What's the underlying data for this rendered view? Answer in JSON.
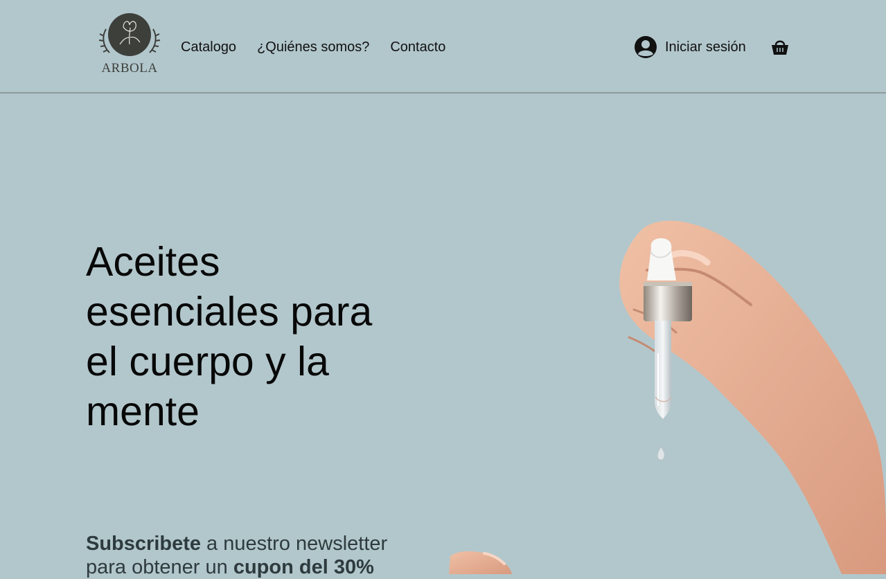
{
  "header": {
    "brand": "ARBOLA",
    "nav": [
      {
        "label": "Catalogo"
      },
      {
        "label": "¿Quiénes somos?"
      },
      {
        "label": "Contacto"
      }
    ],
    "login_label": "Iniciar sesión",
    "icons": {
      "logo": "arbola-logo",
      "account": "account-icon",
      "cart": "shopping-basket-icon"
    }
  },
  "hero": {
    "title": "Aceites esenciales para el cuerpo y la mente",
    "newsletter": {
      "part1": "Subscribete",
      "part2": " a nuestro newsletter para obtener un ",
      "part3": "cupon del 30%"
    },
    "image": "hand-holding-dropper-pipette"
  },
  "colors": {
    "background": "#b2c7cc",
    "divider": "#8e9a9b",
    "logo_dark": "#3d3f3b",
    "text": "#111111",
    "newsletter_text": "#2e3b3e"
  }
}
